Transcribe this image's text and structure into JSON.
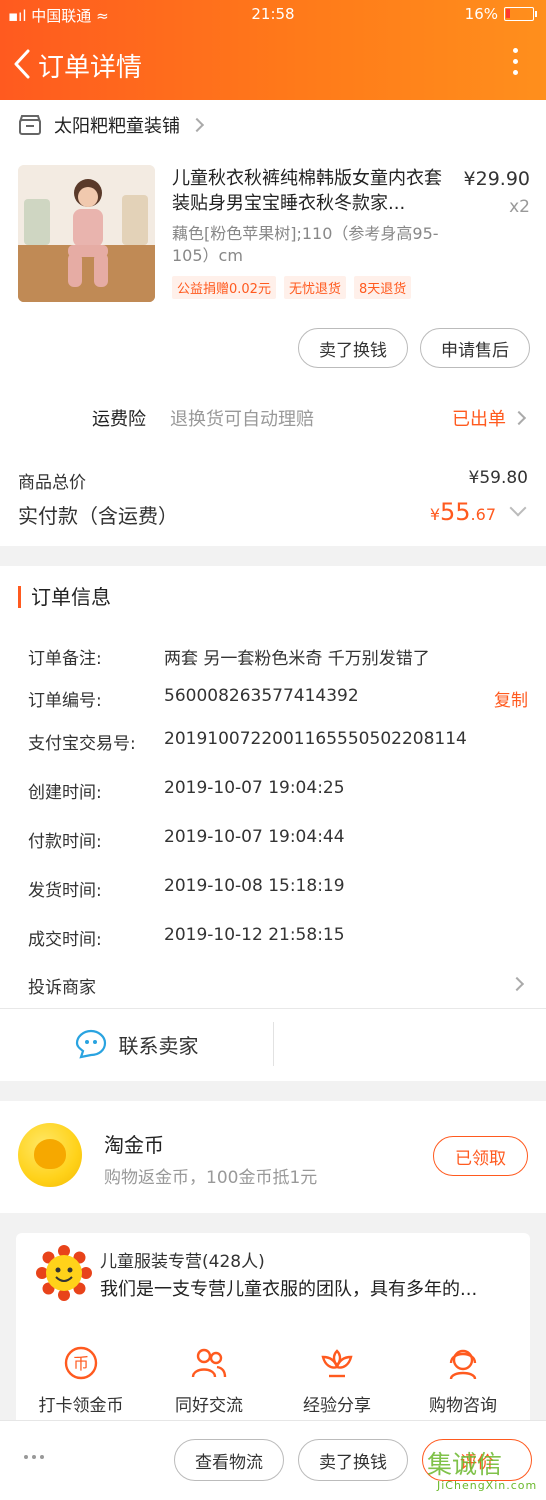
{
  "status_bar": {
    "carrier": "中国联通",
    "time": "21:58",
    "battery": "16%",
    "battery_level": 0.16
  },
  "nav": {
    "title": "订单详情"
  },
  "shop": {
    "name": "太阳粑粑童装铺"
  },
  "product": {
    "title": "儿童秋衣秋裤纯棉韩版女童内衣套装贴身男宝宝睡衣秋冬款家...",
    "price": "¥29.90",
    "qty": "x2",
    "sku": "藕色[粉色苹果树];110（参考身高95-105）cm",
    "tags": [
      "公益捐赠0.02元",
      "无忧退货",
      "8天退货"
    ]
  },
  "item_actions": {
    "exchange": "卖了换钱",
    "after_sale": "申请售后"
  },
  "insurance": {
    "label": "运费险",
    "desc": "退换货可自动理赔",
    "status": "已出单"
  },
  "totals": {
    "goods_label": "商品总价",
    "goods_value": "¥59.80",
    "paid_label": "实付款（含运费）",
    "paid_currency": "¥",
    "paid_int": "55",
    "paid_dec": ".67"
  },
  "order_info": {
    "title": "订单信息",
    "rows": [
      {
        "label": "订单备注:",
        "value": "两套 另一套粉色米奇 千万别发错了"
      },
      {
        "label": "订单编号:",
        "value": "560008263577414392"
      },
      {
        "label": "支付宝交易号:",
        "value": "2019100722001165550502208114"
      },
      {
        "label": "创建时间:",
        "value": "2019-10-07 19:04:25"
      },
      {
        "label": "付款时间:",
        "value": "2019-10-07 19:04:44"
      },
      {
        "label": "发货时间:",
        "value": "2019-10-08 15:18:19"
      },
      {
        "label": "成交时间:",
        "value": "2019-10-12 21:58:15"
      }
    ],
    "copy": "复制",
    "complain": "投诉商家",
    "contact": "联系卖家"
  },
  "coins": {
    "title": "淘金币",
    "desc": "购物返金币，100金币抵1元",
    "button": "已领取"
  },
  "group": {
    "name": "儿童服装专营(428人)",
    "desc": "我们是一支专营儿童衣服的团队，具有多年的...",
    "features": [
      "打卡领金币",
      "同好交流",
      "经验分享",
      "购物咨询"
    ]
  },
  "bottom_bar": {
    "logistics": "查看物流",
    "exchange": "卖了换钱",
    "review": "评价"
  },
  "watermark": {
    "main": "集诚信",
    "sub": "JiChengXin.com"
  },
  "colors": {
    "accent": "#ff5a1f",
    "header_start": "#ff5a1f",
    "header_end": "#ff8f1c"
  }
}
